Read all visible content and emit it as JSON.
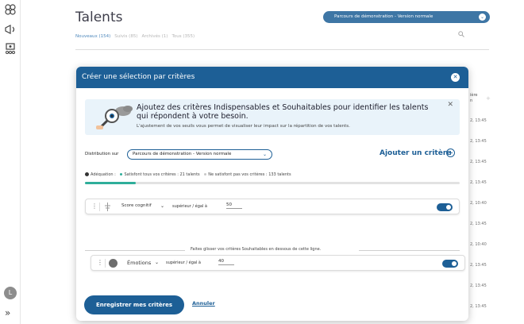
{
  "rail": {
    "icons": [
      "users-group-icon",
      "megaphone-icon",
      "team-card-icon"
    ],
    "avatar_initial": "L",
    "expand_glyph": "»"
  },
  "page": {
    "title": "Talents",
    "program_select": "Parcours de démonstration - Version normale",
    "tabs": [
      {
        "label": "Nouveaux (154)",
        "active": true
      },
      {
        "label": "Suivis (85)",
        "active": false
      },
      {
        "label": "Archivés (1)",
        "active": false
      },
      {
        "label": "Tous (355)",
        "active": false
      }
    ],
    "column_header": "ière\nn",
    "times": [
      "2, 13:45",
      "2, 13:45",
      "2, 13:45",
      "2, 13:45",
      "2, 10:40",
      "2, 13:45",
      "2, 10:40",
      "2, 13:45",
      "2, 13:45",
      "2, 13:45"
    ]
  },
  "modal": {
    "title": "Créer une sélection par critères",
    "info_title": "Ajoutez des critères Indispensables et Souhaitables pour identifier les talents qui répondent à votre besoin.",
    "info_sub": "L'ajustement de vos seuils vous permet de visualiser leur impact sur la répartition de vos talents.",
    "distribution_label": "Distribution sur",
    "distribution_value": "Parcours de démonstration - Version normale",
    "add_criterion": "Ajouter un critère",
    "adequation_label": "Adéquation :",
    "legend_satisfied": "Satisfont tous vos critères : 21 talents",
    "legend_not_satisfied": "Ne satisfont pas vos critères : 133 talents",
    "progress_fraction": 0.136,
    "criteria": [
      {
        "name": "Score cognitif",
        "comparator": "supérieur / égal à",
        "value": "50",
        "enabled": true
      },
      {
        "name": "Émotions",
        "comparator": "supérieur / égal à",
        "value": "40",
        "enabled": true
      }
    ],
    "divider_text": "Faites glisser vos critères Souhaitables en dessous de cette ligne.",
    "save_button": "Enregistrer mes critères",
    "cancel_button": "Annuler"
  },
  "colors": {
    "primary": "#1d5f96",
    "satisfied": "#2fae9a",
    "unsatisfied": "#c8c8c8"
  }
}
